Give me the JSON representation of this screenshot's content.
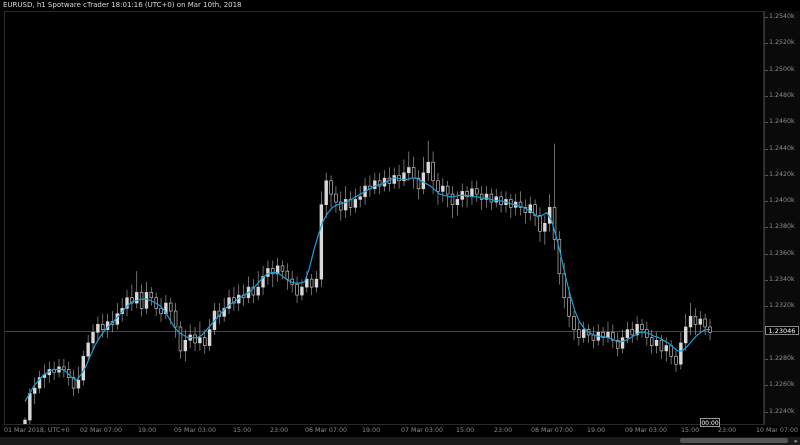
{
  "window": {
    "title": "EURUSD, h1 Spotware cTrader 18:01:16 (UTC+0) on Mar 10th, 2018"
  },
  "price_scale": {
    "ticks": [
      "1.2540k",
      "1.2520k",
      "1.2500k",
      "1.2480k",
      "1.2460k",
      "1.2440k",
      "1.2420k",
      "1.2400k",
      "1.2380k",
      "1.2360k",
      "1.2340k",
      "1.2320k",
      "1.2300k",
      "1.2280k",
      "1.2260k",
      "1.2240k"
    ],
    "current_price": "1.23046"
  },
  "time_axis": {
    "labels": [
      "01 Mar 2018, UTC+0",
      "02 Mar 07:00",
      "19:00",
      "05 Mar 03:00",
      "15:00",
      "23:00",
      "06 Mar 07:00",
      "19:00",
      "07 Mar 03:00",
      "15:00",
      "23:00",
      "08 Mar 07:00",
      "19:00",
      "09 Mar 03:00",
      "15:00",
      "23:00",
      "10 Mar 07:00"
    ],
    "cursor_time": "00:00"
  },
  "colors": {
    "background": "#000000",
    "candle_body": "#d8d8d8",
    "ma_line": "#1a9fd6",
    "current_price_line": "#444444"
  },
  "chart_data": {
    "type": "candlestick",
    "symbol": "EURUSD",
    "timeframe": "h1",
    "ylim": [
      1.2235,
      1.2545
    ],
    "candles": [
      [
        1.223,
        1.2238,
        1.2222,
        1.224
      ],
      [
        1.2238,
        1.2258,
        1.2235,
        1.2262
      ],
      [
        1.2258,
        1.2262,
        1.225,
        1.227
      ],
      [
        1.2262,
        1.227,
        1.2258,
        1.2275
      ],
      [
        1.227,
        1.2272,
        1.2262,
        1.228
      ],
      [
        1.2272,
        1.2276,
        1.2266,
        1.2282
      ],
      [
        1.2276,
        1.2274,
        1.2268,
        1.2282
      ],
      [
        1.2274,
        1.2278,
        1.227,
        1.2284
      ],
      [
        1.2278,
        1.2276,
        1.227,
        1.2284
      ],
      [
        1.2276,
        1.227,
        1.2264,
        1.2282
      ],
      [
        1.227,
        1.2262,
        1.2256,
        1.2276
      ],
      [
        1.2262,
        1.2268,
        1.2258,
        1.2278
      ],
      [
        1.2268,
        1.2286,
        1.2264,
        1.229
      ],
      [
        1.2286,
        1.2296,
        1.2282,
        1.2302
      ],
      [
        1.2296,
        1.2304,
        1.229,
        1.231
      ],
      [
        1.2304,
        1.231,
        1.2298,
        1.2316
      ],
      [
        1.231,
        1.2306,
        1.23,
        1.2318
      ],
      [
        1.2306,
        1.2312,
        1.23,
        1.2318
      ],
      [
        1.2312,
        1.231,
        1.2304,
        1.232
      ],
      [
        1.231,
        1.2318,
        1.2306,
        1.2326
      ],
      [
        1.2318,
        1.2322,
        1.2312,
        1.233
      ],
      [
        1.2322,
        1.233,
        1.2316,
        1.2336
      ],
      [
        1.233,
        1.2326,
        1.232,
        1.234
      ],
      [
        1.2326,
        1.2334,
        1.2322,
        1.235
      ],
      [
        1.2334,
        1.2322,
        1.2316,
        1.234
      ],
      [
        1.2322,
        1.2334,
        1.2318,
        1.2342
      ],
      [
        1.2334,
        1.233,
        1.2324,
        1.2338
      ],
      [
        1.233,
        1.2322,
        1.2316,
        1.2334
      ],
      [
        1.2322,
        1.2318,
        1.2312,
        1.233
      ],
      [
        1.2318,
        1.2326,
        1.2314,
        1.2332
      ],
      [
        1.2326,
        1.232,
        1.231,
        1.233
      ],
      [
        1.232,
        1.2308,
        1.23,
        1.2326
      ],
      [
        1.2308,
        1.229,
        1.2284,
        1.2312
      ],
      [
        1.229,
        1.2298,
        1.2282,
        1.2306
      ],
      [
        1.2298,
        1.2302,
        1.2292,
        1.231
      ],
      [
        1.2302,
        1.2296,
        1.229,
        1.2308
      ],
      [
        1.2296,
        1.23,
        1.229,
        1.2312
      ],
      [
        1.23,
        1.2294,
        1.2288,
        1.2306
      ],
      [
        1.2294,
        1.2306,
        1.229,
        1.2314
      ],
      [
        1.2306,
        1.232,
        1.2302,
        1.2326
      ],
      [
        1.232,
        1.2316,
        1.231,
        1.2326
      ],
      [
        1.2316,
        1.2322,
        1.2312,
        1.233
      ],
      [
        1.2322,
        1.233,
        1.2318,
        1.2336
      ],
      [
        1.233,
        1.2326,
        1.232,
        1.2338
      ],
      [
        1.2326,
        1.2332,
        1.232,
        1.234
      ],
      [
        1.2332,
        1.233,
        1.2324,
        1.234
      ],
      [
        1.233,
        1.2338,
        1.2326,
        1.2346
      ],
      [
        1.2338,
        1.2332,
        1.2326,
        1.2344
      ],
      [
        1.2332,
        1.2338,
        1.2328,
        1.235
      ],
      [
        1.2338,
        1.2346,
        1.2332,
        1.2354
      ],
      [
        1.2346,
        1.2352,
        1.234,
        1.2358
      ],
      [
        1.2352,
        1.2348,
        1.2338,
        1.2358
      ],
      [
        1.2348,
        1.2354,
        1.2342,
        1.236
      ],
      [
        1.2354,
        1.235,
        1.2344,
        1.2358
      ],
      [
        1.235,
        1.2344,
        1.2336,
        1.2356
      ],
      [
        1.2344,
        1.234,
        1.2334,
        1.235
      ],
      [
        1.234,
        1.2332,
        1.2326,
        1.2346
      ],
      [
        1.2332,
        1.2338,
        1.2328,
        1.2344
      ],
      [
        1.2338,
        1.2344,
        1.2334,
        1.235
      ],
      [
        1.2344,
        1.2338,
        1.2332,
        1.2348
      ],
      [
        1.2338,
        1.2344,
        1.2334,
        1.235
      ],
      [
        1.2344,
        1.24,
        1.2338,
        1.241
      ],
      [
        1.24,
        1.2418,
        1.239,
        1.2424
      ],
      [
        1.2418,
        1.2408,
        1.2398,
        1.2422
      ],
      [
        1.2408,
        1.2402,
        1.2394,
        1.2414
      ],
      [
        1.2402,
        1.2396,
        1.2388,
        1.241
      ],
      [
        1.2396,
        1.2404,
        1.239,
        1.2414
      ],
      [
        1.2404,
        1.2398,
        1.2392,
        1.241
      ],
      [
        1.2398,
        1.2404,
        1.2394,
        1.2412
      ],
      [
        1.2404,
        1.2406,
        1.2398,
        1.2414
      ],
      [
        1.2406,
        1.2414,
        1.24,
        1.242
      ],
      [
        1.2414,
        1.2412,
        1.2406,
        1.2422
      ],
      [
        1.2412,
        1.2418,
        1.2408,
        1.2424
      ],
      [
        1.2418,
        1.2414,
        1.2408,
        1.2424
      ],
      [
        1.2414,
        1.242,
        1.241,
        1.2426
      ],
      [
        1.242,
        1.2416,
        1.241,
        1.2428
      ],
      [
        1.2416,
        1.2422,
        1.2412,
        1.2428
      ],
      [
        1.2422,
        1.2418,
        1.2412,
        1.243
      ],
      [
        1.2418,
        1.2424,
        1.2414,
        1.2434
      ],
      [
        1.2424,
        1.2428,
        1.2418,
        1.244
      ],
      [
        1.2428,
        1.242,
        1.2412,
        1.2436
      ],
      [
        1.242,
        1.2412,
        1.2404,
        1.2426
      ],
      [
        1.2412,
        1.2424,
        1.2408,
        1.2436
      ],
      [
        1.2424,
        1.2432,
        1.2418,
        1.2448
      ],
      [
        1.2432,
        1.2418,
        1.2408,
        1.244
      ],
      [
        1.2418,
        1.241,
        1.24,
        1.2424
      ],
      [
        1.241,
        1.2414,
        1.2402,
        1.242
      ],
      [
        1.2414,
        1.2408,
        1.2398,
        1.2418
      ],
      [
        1.2408,
        1.24,
        1.239,
        1.2414
      ],
      [
        1.24,
        1.2404,
        1.2392,
        1.241
      ],
      [
        1.2404,
        1.241,
        1.2398,
        1.2416
      ],
      [
        1.241,
        1.2406,
        1.2398,
        1.2414
      ],
      [
        1.2406,
        1.2412,
        1.24,
        1.2418
      ],
      [
        1.2412,
        1.2408,
        1.2402,
        1.2418
      ],
      [
        1.2408,
        1.2404,
        1.2396,
        1.2414
      ],
      [
        1.2404,
        1.2408,
        1.2398,
        1.2414
      ],
      [
        1.2408,
        1.2402,
        1.2396,
        1.2412
      ],
      [
        1.2402,
        1.2406,
        1.2398,
        1.2412
      ],
      [
        1.2406,
        1.24,
        1.2394,
        1.241
      ],
      [
        1.24,
        1.2404,
        1.2394,
        1.241
      ],
      [
        1.2404,
        1.2398,
        1.239,
        1.2408
      ],
      [
        1.2398,
        1.2402,
        1.2392,
        1.2408
      ],
      [
        1.2402,
        1.2398,
        1.2392,
        1.241
      ],
      [
        1.2398,
        1.2394,
        1.2386,
        1.2404
      ],
      [
        1.2394,
        1.24,
        1.2388,
        1.2406
      ],
      [
        1.24,
        1.2392,
        1.2384,
        1.2404
      ],
      [
        1.2392,
        1.238,
        1.2372,
        1.2398
      ],
      [
        1.238,
        1.2386,
        1.237,
        1.2392
      ],
      [
        1.2386,
        1.2398,
        1.238,
        1.2408
      ],
      [
        1.2398,
        1.2374,
        1.2366,
        1.2446
      ],
      [
        1.2374,
        1.2348,
        1.234,
        1.238
      ],
      [
        1.2348,
        1.233,
        1.2322,
        1.2356
      ],
      [
        1.233,
        1.2316,
        1.2308,
        1.2338
      ],
      [
        1.2316,
        1.2306,
        1.2298,
        1.232
      ],
      [
        1.2306,
        1.23,
        1.2294,
        1.2312
      ],
      [
        1.23,
        1.2306,
        1.2296,
        1.2312
      ],
      [
        1.2306,
        1.2302,
        1.2296,
        1.231
      ],
      [
        1.2302,
        1.2298,
        1.2292,
        1.2308
      ],
      [
        1.2298,
        1.2304,
        1.2294,
        1.231
      ],
      [
        1.2304,
        1.23,
        1.2294,
        1.2308
      ],
      [
        1.23,
        1.2304,
        1.2296,
        1.2312
      ],
      [
        1.2304,
        1.2298,
        1.2292,
        1.231
      ],
      [
        1.2298,
        1.2292,
        1.2286,
        1.2304
      ],
      [
        1.2292,
        1.23,
        1.2288,
        1.2306
      ],
      [
        1.23,
        1.2306,
        1.2296,
        1.2312
      ],
      [
        1.2306,
        1.2302,
        1.2296,
        1.2312
      ],
      [
        1.2302,
        1.231,
        1.2298,
        1.2316
      ],
      [
        1.231,
        1.2306,
        1.23,
        1.2314
      ],
      [
        1.2306,
        1.23,
        1.2294,
        1.2312
      ],
      [
        1.23,
        1.2294,
        1.2288,
        1.2306
      ],
      [
        1.2294,
        1.2298,
        1.2288,
        1.2304
      ],
      [
        1.2298,
        1.229,
        1.2284,
        1.2302
      ],
      [
        1.229,
        1.2294,
        1.2282,
        1.23
      ],
      [
        1.2294,
        1.2286,
        1.228,
        1.2298
      ],
      [
        1.2286,
        1.228,
        1.2274,
        1.2292
      ],
      [
        1.228,
        1.2296,
        1.2276,
        1.2304
      ],
      [
        1.2296,
        1.2308,
        1.229,
        1.2318
      ],
      [
        1.2308,
        1.2316,
        1.2302,
        1.2326
      ],
      [
        1.2316,
        1.231,
        1.2302,
        1.2322
      ],
      [
        1.231,
        1.2314,
        1.2304,
        1.232
      ],
      [
        1.2314,
        1.2308,
        1.2302,
        1.2318
      ],
      [
        1.2308,
        1.2304,
        1.2298,
        1.2314
      ]
    ],
    "moving_average": [
      1.2252,
      1.2258,
      1.2264,
      1.2268,
      1.2272,
      1.2274,
      1.2276,
      1.2276,
      1.2276,
      1.2274,
      1.227,
      1.2268,
      1.2272,
      1.2278,
      1.2286,
      1.2294,
      1.23,
      1.2305,
      1.2309,
      1.2312,
      1.2316,
      1.232,
      1.2324,
      1.2327,
      1.2328,
      1.2329,
      1.2329,
      1.2328,
      1.2326,
      1.2324,
      1.232,
      1.2314,
      1.2308,
      1.2304,
      1.2302,
      1.23,
      1.23,
      1.23,
      1.2302,
      1.2306,
      1.231,
      1.2314,
      1.2318,
      1.2322,
      1.2325,
      1.2327,
      1.233,
      1.2332,
      1.2334,
      1.2337,
      1.2341,
      1.2345,
      1.2348,
      1.2349,
      1.2349,
      1.2347,
      1.2344,
      1.2342,
      1.2341,
      1.2341,
      1.2342,
      1.2352,
      1.2366,
      1.2378,
      1.2388,
      1.2394,
      1.2398,
      1.24,
      1.2401,
      1.2402,
      1.2404,
      1.2406,
      1.2408,
      1.241,
      1.2412,
      1.2414,
      1.2415,
      1.2416,
      1.2418,
      1.242,
      1.242,
      1.2419,
      1.2419,
      1.242,
      1.242,
      1.2418,
      1.2416,
      1.2414,
      1.2411,
      1.2408,
      1.2407,
      1.2406,
      1.2406,
      1.2407,
      1.2407,
      1.2407,
      1.2406,
      1.2406,
      1.2405,
      1.2405,
      1.2404,
      1.2403,
      1.2403,
      1.2402,
      1.2401,
      1.24,
      1.2399,
      1.2398,
      1.2396,
      1.2394,
      1.2391,
      1.2392,
      1.2394,
      1.2388,
      1.2376,
      1.2362,
      1.2346,
      1.2332,
      1.232,
      1.2312,
      1.2307,
      1.2304,
      1.2302,
      1.2301,
      1.2301,
      1.23,
      1.2299,
      1.2297,
      1.2297,
      1.2298,
      1.23,
      1.2302,
      1.2304,
      1.2304,
      1.2303,
      1.2301,
      1.23,
      1.2298,
      1.2296,
      1.2293,
      1.229,
      1.229,
      1.2293,
      1.2297,
      1.2301,
      1.2304,
      1.2306,
      1.2306
    ]
  }
}
